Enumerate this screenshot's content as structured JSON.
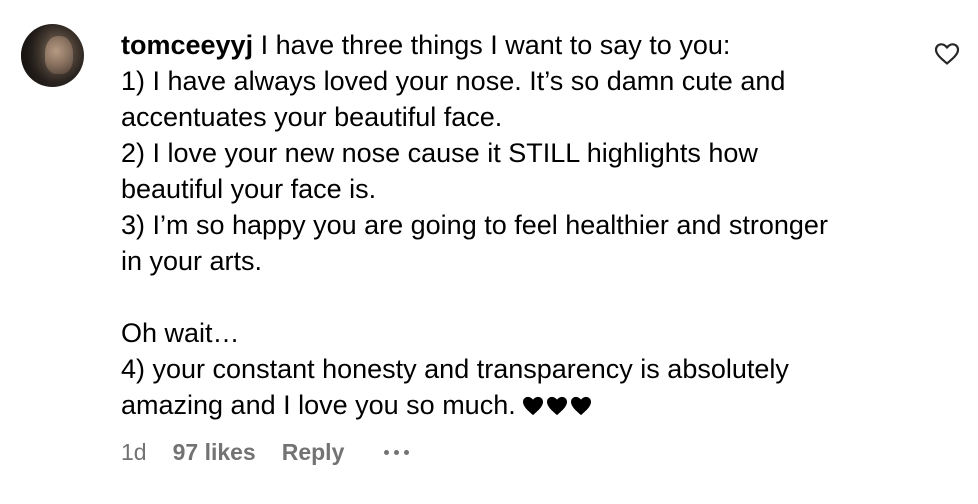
{
  "comment": {
    "username": "tomceeyyj",
    "lines": [
      " I have three things I want to say to you:",
      "1) I have always loved your nose. It’s so damn cute and",
      "accentuates your beautiful face.",
      "2) I love your new nose cause it STILL highlights how",
      "beautiful your face is.",
      "3) I’m so happy you are going to feel healthier and stronger",
      "in your arts.",
      "",
      "Oh wait…",
      "4) your constant honesty and transparency is absolutely",
      "amazing and I love you so much."
    ],
    "emoji_hearts": [
      "black-heart",
      "black-heart",
      "black-heart"
    ]
  },
  "footer": {
    "time": "1d",
    "likes": "97 likes",
    "reply": "Reply"
  },
  "icons": {
    "like": "heart-outline-icon",
    "more": "more-options-icon"
  },
  "colors": {
    "text": "#000000",
    "secondary": "#737373",
    "background": "#ffffff"
  }
}
